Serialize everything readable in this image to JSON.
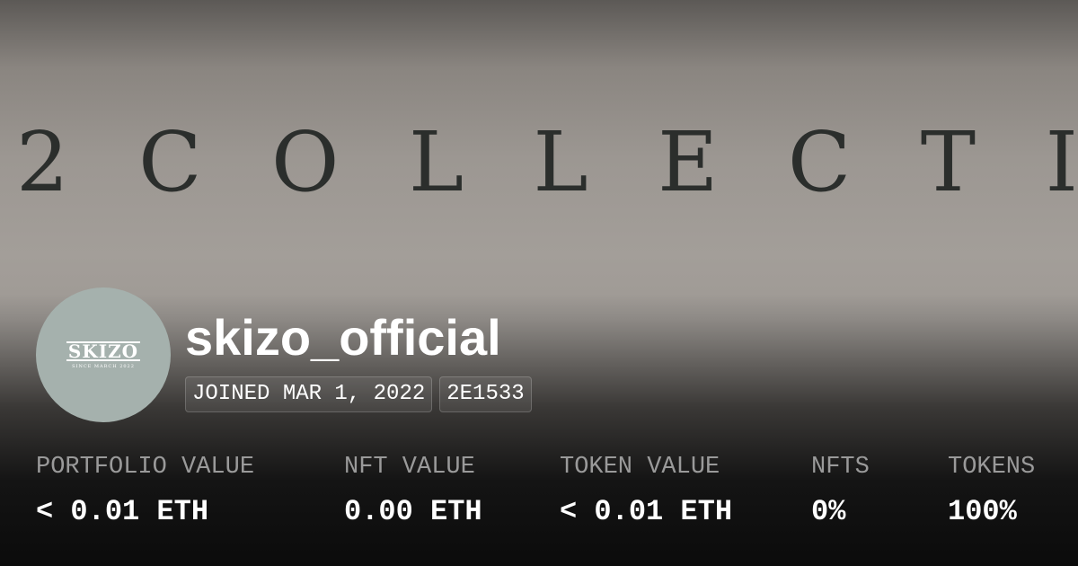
{
  "banner": {
    "letters": [
      "2",
      "C",
      "O",
      "L",
      "L",
      "E",
      "C",
      "T",
      "I"
    ]
  },
  "avatar": {
    "logo_text": "SKIZO",
    "sub_text": "SINCE MARCH 2022"
  },
  "profile": {
    "username": "skizo_official",
    "joined": "JOINED MAR 1, 2022",
    "address": "2E1533"
  },
  "stats": [
    {
      "label": "PORTFOLIO VALUE",
      "value": "< 0.01 ETH"
    },
    {
      "label": "NFT VALUE",
      "value": "0.00 ETH"
    },
    {
      "label": "TOKEN VALUE",
      "value": "< 0.01 ETH"
    },
    {
      "label": "NFTS",
      "value": "0%"
    },
    {
      "label": "TOKENS",
      "value": "100%"
    }
  ]
}
